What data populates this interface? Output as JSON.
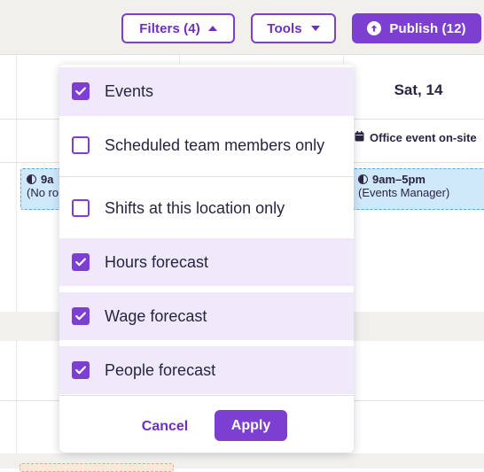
{
  "toolbar": {
    "filters_label": "Filters (4)",
    "tools_label": "Tools",
    "publish_label": "Publish (12)"
  },
  "calendar": {
    "day_header": "Sat, 14",
    "event_chip_label": "Office event on-site",
    "shift_left_time": "9a",
    "shift_left_role": "(No ro",
    "shift_right_time": "9am–5pm",
    "shift_right_role": "(Events Manager)"
  },
  "filters_menu": {
    "options": [
      {
        "label": "Events",
        "checked": true
      },
      {
        "label": "Scheduled team members only",
        "checked": false
      },
      {
        "label": "Shifts at this location only",
        "checked": false
      },
      {
        "label": "Hours forecast",
        "checked": true
      },
      {
        "label": "Wage forecast",
        "checked": true
      },
      {
        "label": "People forecast",
        "checked": true
      }
    ],
    "cancel_label": "Cancel",
    "apply_label": "Apply"
  },
  "colors": {
    "accent": "#7c3fd1",
    "checked_row_bg": "#efe9fb",
    "toolbar_bg": "#f1f0ed",
    "shift_card_bg": "#cfe9fb"
  },
  "icons": {
    "filters_caret": "caret-up-icon",
    "tools_caret": "caret-down-icon",
    "publish": "arrow-up-circle-icon",
    "event_chip": "calendar-icon",
    "shift": "half-circle-icon",
    "checkbox_checked": "checkmark-icon"
  }
}
